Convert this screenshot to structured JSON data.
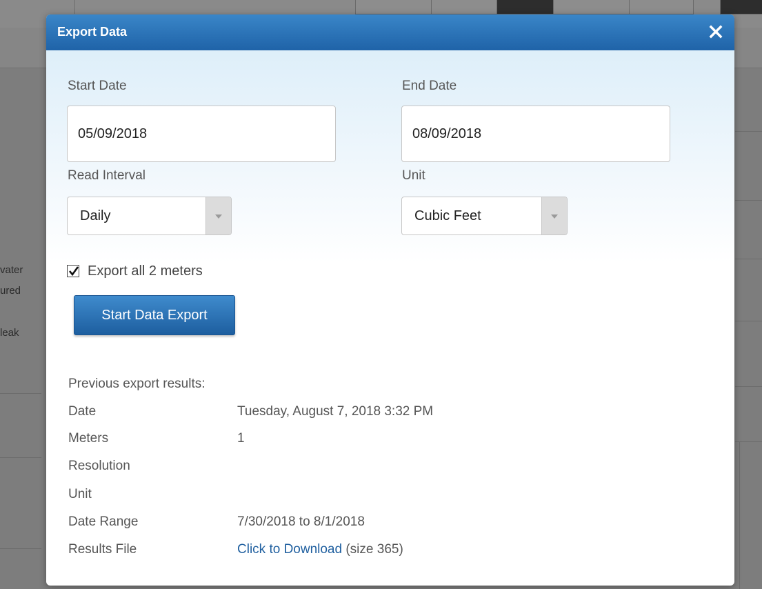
{
  "background": {
    "side_text": [
      "vater",
      "ured",
      "leak"
    ]
  },
  "modal": {
    "title": "Export Data",
    "close_icon": "close-icon",
    "start_date": {
      "label": "Start Date",
      "value": "05/09/2018"
    },
    "end_date": {
      "label": "End Date",
      "value": "08/09/2018"
    },
    "read_interval": {
      "label": "Read Interval",
      "value": "Daily"
    },
    "unit": {
      "label": "Unit",
      "value": "Cubic Feet"
    },
    "export_all": {
      "label": "Export all 2 meters",
      "checked": true
    },
    "export_button": "Start Data Export",
    "previous": {
      "title": "Previous export results:",
      "rows": [
        {
          "label": "Date",
          "value": "Tuesday, August 7, 2018 3:32 PM"
        },
        {
          "label": "Meters",
          "value": "1"
        },
        {
          "label": "Resolution",
          "value": ""
        },
        {
          "label": "Unit",
          "value": ""
        },
        {
          "label": "Date Range",
          "value": "7/30/2018 to 8/1/2018"
        },
        {
          "label": "Results File",
          "link": "Click to Download",
          "suffix": " (size 365)"
        }
      ]
    }
  },
  "colors": {
    "header": "#1f63a8",
    "button": "#2a70b5",
    "link": "#1f5f9f"
  }
}
